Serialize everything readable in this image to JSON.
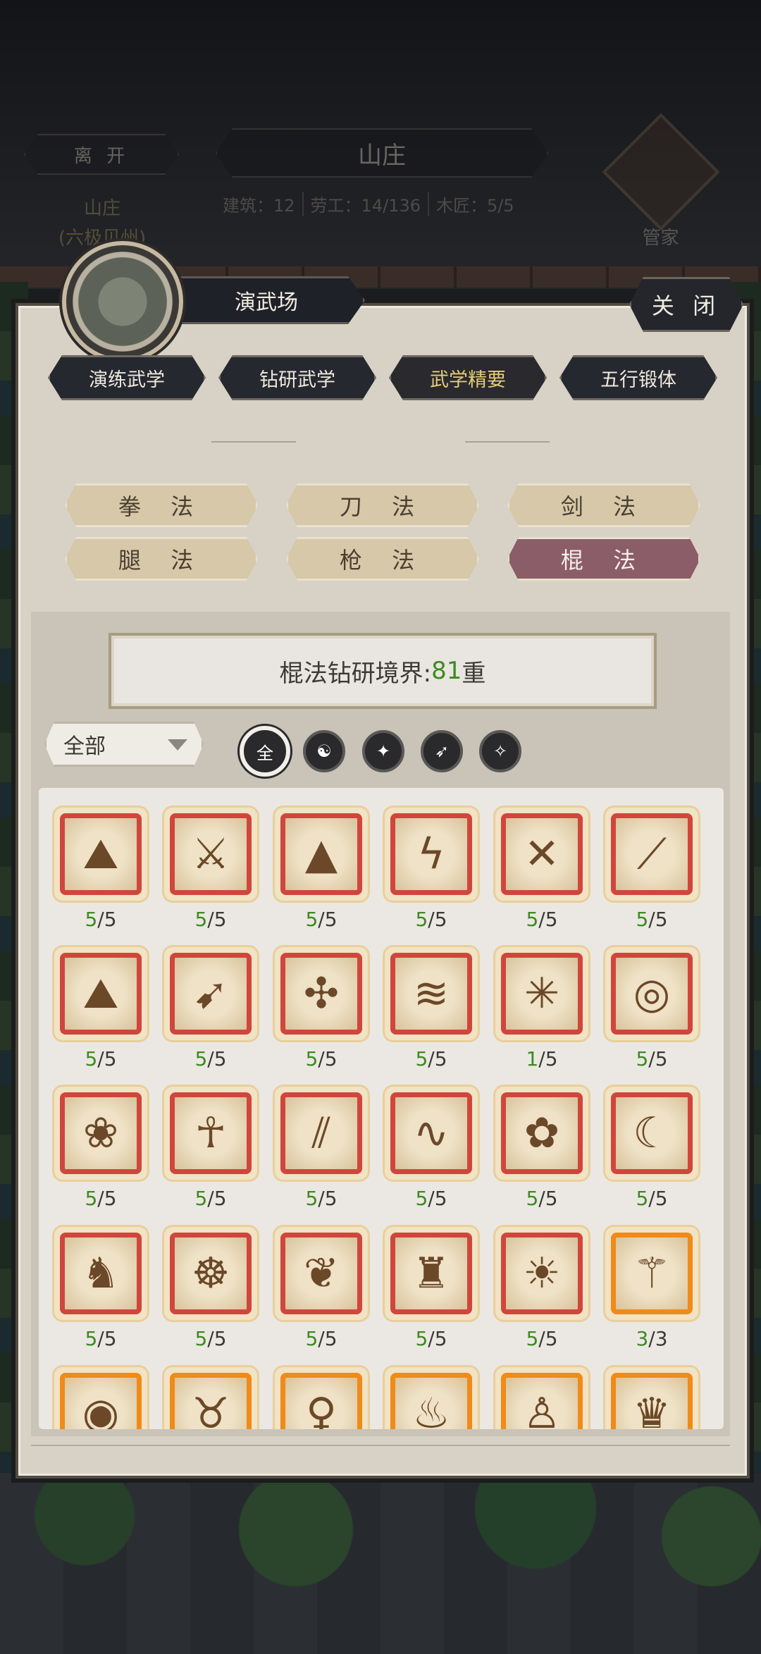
{
  "header": {
    "leave_label": "离 开",
    "title": "山庄",
    "stats": [
      "建筑：12",
      "劳工：14/136",
      "木匠：5/5"
    ],
    "location_line1": "山庄",
    "location_line2": "(六极贝州)",
    "steward_label": "管家"
  },
  "building": {
    "name": "演武场",
    "close_label": "关 闭"
  },
  "tabs": [
    "演练武学",
    "钻研武学",
    "武学精要",
    "五行锻体"
  ],
  "active_tab": 2,
  "categories": [
    "拳 法",
    "刀 法",
    "剑 法",
    "腿 法",
    "枪 法",
    "棍 法"
  ],
  "active_category": 5,
  "realm": {
    "prefix": "棍法钻研境界:",
    "level": "81",
    "suffix": "重"
  },
  "filter": {
    "dropdown_value": "全部",
    "element_filters": [
      {
        "name": "all",
        "glyph": "全"
      },
      {
        "name": "yinyang",
        "glyph": "☯"
      },
      {
        "name": "metal",
        "glyph": "✦"
      },
      {
        "name": "wood",
        "glyph": "➶"
      },
      {
        "name": "water",
        "glyph": "✧"
      }
    ]
  },
  "skills": [
    {
      "icon": "mountain-staff-icon",
      "glyph": "⛰",
      "cur": "5",
      "max": "/5",
      "tier": "red"
    },
    {
      "icon": "kneeling-staff-icon",
      "glyph": "⚔",
      "cur": "5",
      "max": "/5",
      "tier": "red"
    },
    {
      "icon": "peaks-icon",
      "glyph": "▲",
      "cur": "5",
      "max": "/5",
      "tier": "red"
    },
    {
      "icon": "lightning-staff-icon",
      "glyph": "ϟ",
      "cur": "5",
      "max": "/5",
      "tier": "red"
    },
    {
      "icon": "crossed-staff-icon",
      "glyph": "✕",
      "cur": "5",
      "max": "/5",
      "tier": "red"
    },
    {
      "icon": "sweeping-staff-icon",
      "glyph": "⟋",
      "cur": "5",
      "max": "/5",
      "tier": "red"
    },
    {
      "icon": "volcano-icon",
      "glyph": "⛰",
      "cur": "5",
      "max": "/5",
      "tier": "red"
    },
    {
      "icon": "arrows-icon",
      "glyph": "➹",
      "cur": "5",
      "max": "/5",
      "tier": "red"
    },
    {
      "icon": "branch-staff-icon",
      "glyph": "✣",
      "cur": "5",
      "max": "/5",
      "tier": "red"
    },
    {
      "icon": "wind-staff-icon",
      "glyph": "≋",
      "cur": "5",
      "max": "/5",
      "tier": "red"
    },
    {
      "icon": "star-strike-icon",
      "glyph": "✳",
      "cur": "1",
      "max": "/5",
      "tier": "red"
    },
    {
      "icon": "whirl-staff-icon",
      "glyph": "◎",
      "cur": "5",
      "max": "/5",
      "tier": "red"
    },
    {
      "icon": "lotus-icon",
      "glyph": "❀",
      "cur": "5",
      "max": "/5",
      "tier": "red"
    },
    {
      "icon": "fighter-icon",
      "glyph": "☥",
      "cur": "5",
      "max": "/5",
      "tier": "red"
    },
    {
      "icon": "triple-staff-icon",
      "glyph": "⫽",
      "cur": "5",
      "max": "/5",
      "tier": "red"
    },
    {
      "icon": "swirl-staff-icon",
      "glyph": "∿",
      "cur": "5",
      "max": "/5",
      "tier": "red"
    },
    {
      "icon": "flower-staff-icon",
      "glyph": "✿",
      "cur": "5",
      "max": "/5",
      "tier": "red"
    },
    {
      "icon": "meditating-moon-icon",
      "glyph": "☾",
      "cur": "5",
      "max": "/5",
      "tier": "red"
    },
    {
      "icon": "lion-warrior-icon",
      "glyph": "♞",
      "cur": "5",
      "max": "/5",
      "tier": "red"
    },
    {
      "icon": "meditation-icon",
      "glyph": "☸",
      "cur": "5",
      "max": "/5",
      "tier": "red"
    },
    {
      "icon": "phoenix-icon",
      "glyph": "❦",
      "cur": "5",
      "max": "/5",
      "tier": "red"
    },
    {
      "icon": "dragon-head-icon",
      "glyph": "♜",
      "cur": "5",
      "max": "/5",
      "tier": "red"
    },
    {
      "icon": "buddha-halo-icon",
      "glyph": "☀",
      "cur": "5",
      "max": "/5",
      "tier": "red"
    },
    {
      "icon": "dagger-cloud-icon",
      "glyph": "⚚",
      "cur": "3",
      "max": "/3",
      "tier": "gold"
    },
    {
      "icon": "ring-strike-icon",
      "glyph": "◉",
      "tier": "gold"
    },
    {
      "icon": "beast-icon",
      "glyph": "♉",
      "tier": "gold"
    },
    {
      "icon": "dancer-icon",
      "glyph": "♀",
      "tier": "gold"
    },
    {
      "icon": "flame-strike-icon",
      "glyph": "♨",
      "tier": "gold"
    },
    {
      "icon": "kick-icon",
      "glyph": "♙",
      "tier": "gold"
    },
    {
      "icon": "seated-master-icon",
      "glyph": "♛",
      "tier": "gold"
    }
  ]
}
